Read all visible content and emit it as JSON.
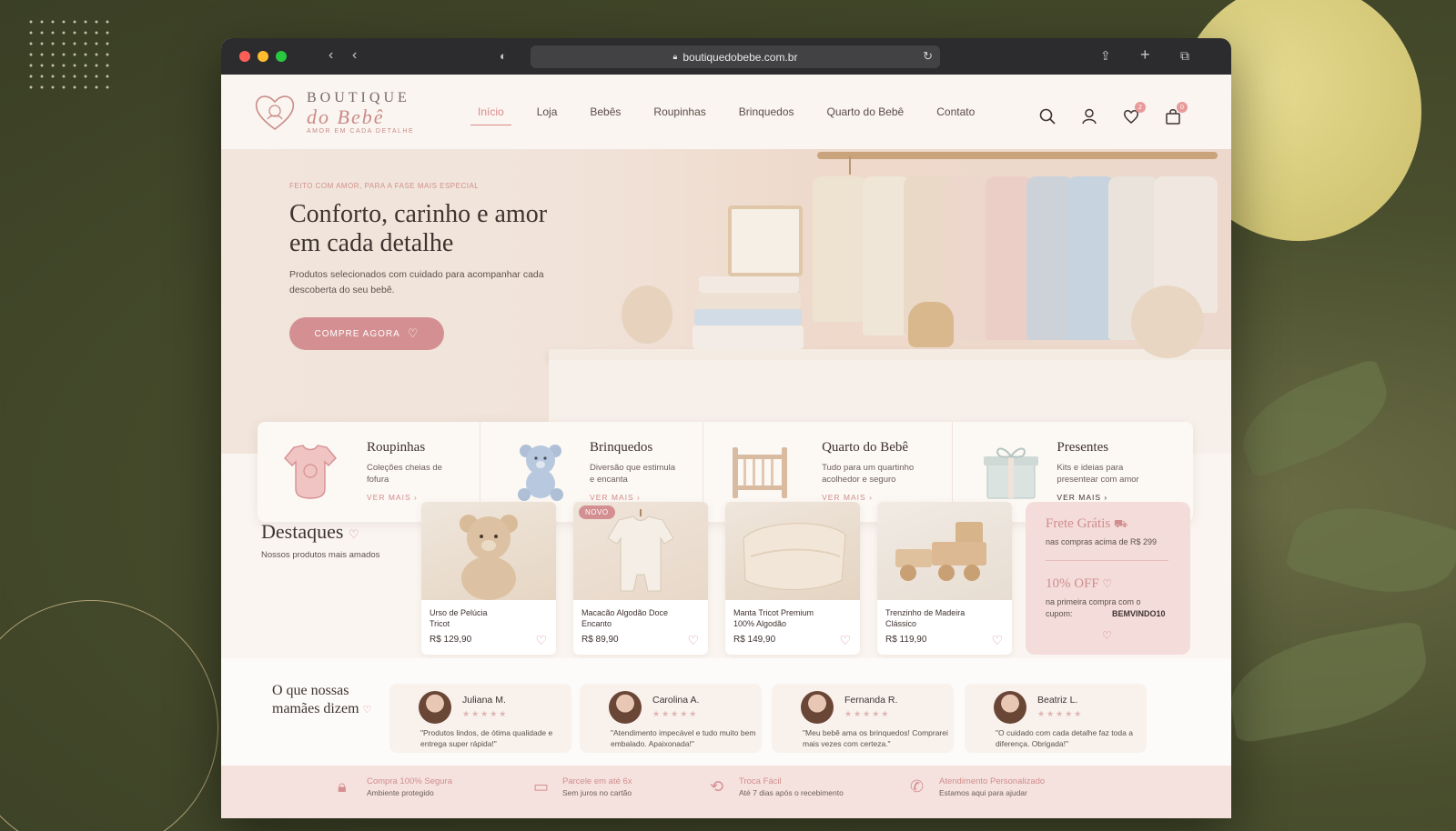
{
  "browser": {
    "url": "boutiquedobebe.com.br"
  },
  "brand": {
    "line1": "BOUTIQUE",
    "line2": "do Bebê",
    "tagline": "AMOR EM CADA DETALHE"
  },
  "nav": {
    "items": [
      "Início",
      "Loja",
      "Bebês",
      "Roupinhas",
      "Brinquedos",
      "Quarto do Bebê",
      "Contato"
    ]
  },
  "header": {
    "wishlist_count": "2",
    "cart_count": "0"
  },
  "hero": {
    "eyebrow": "FEITO COM AMOR, PARA A FASE MAIS ESPECIAL",
    "title": "Conforto, carinho e amor em cada detalhe",
    "subtitle": "Produtos selecionados com cuidado para acompanhar cada descoberta do seu bebê.",
    "cta": "COMPRE AGORA"
  },
  "categories": [
    {
      "title": "Roupinhas",
      "desc": "Coleções cheias de fofura",
      "more": "VER MAIS ›"
    },
    {
      "title": "Brinquedos",
      "desc": "Diversão que estimula e encanta",
      "more": "VER MAIS ›"
    },
    {
      "title": "Quarto do Bebê",
      "desc": "Tudo para um quartinho acolhedor e seguro",
      "more": "VER MAIS ›"
    },
    {
      "title": "Presentes",
      "desc": "Kits e ideias para presentear com amor",
      "more": "VER MAIS ›"
    }
  ],
  "highlights": {
    "title": "Destaques",
    "subtitle": "Nossos produtos mais amados"
  },
  "products": [
    {
      "name": "Urso de Pelúcia Tricot",
      "price": "R$ 129,90"
    },
    {
      "name": "Macacão Algodão Doce Encanto",
      "price": "R$ 89,90",
      "badge": "NOVO"
    },
    {
      "name": "Manta Tricot Premium 100% Algodão",
      "price": "R$ 149,90"
    },
    {
      "name": "Trenzinho de Madeira Clássico",
      "price": "R$ 119,90"
    }
  ],
  "promo": {
    "shipping_title": "Frete Grátis",
    "shipping_sub": "nas compras acima de R$ 299",
    "discount_title": "10% OFF",
    "discount_sub": "na primeira compra com o cupom:",
    "coupon": "BEMVINDO10"
  },
  "testimonials": {
    "title": "O que nossas mamães dizem",
    "items": [
      {
        "name": "Juliana M.",
        "stars": "★★★★★",
        "quote": "\"Produtos lindos, de ótima qualidade e entrega super rápida!\""
      },
      {
        "name": "Carolina A.",
        "stars": "★★★★★",
        "quote": "\"Atendimento impecável e tudo muito bem embalado. Apaixonada!\""
      },
      {
        "name": "Fernanda R.",
        "stars": "★★★★★",
        "quote": "\"Meu bebê ama os brinquedos! Comprarei mais vezes com certeza.\""
      },
      {
        "name": "Beatriz L.",
        "stars": "★★★★★",
        "quote": "\"O cuidado com cada detalhe faz toda a diferença. Obrigada!\""
      }
    ]
  },
  "features": [
    {
      "title": "Compra 100% Segura",
      "sub": "Ambiente protegido",
      "icon": "lock-icon"
    },
    {
      "title": "Parcele em até 6x",
      "sub": "Sem juros no cartão",
      "icon": "card-icon"
    },
    {
      "title": "Troca Fácil",
      "sub": "Até 7 dias após o recebimento",
      "icon": "exchange-icon"
    },
    {
      "title": "Atendimento Personalizado",
      "sub": "Estamos aqui para ajudar",
      "icon": "phone-icon"
    }
  ],
  "colors": {
    "accent": "#d38f91",
    "text": "#3f3330",
    "background": "#faf5f0",
    "promo_bg": "#f3dcda"
  }
}
